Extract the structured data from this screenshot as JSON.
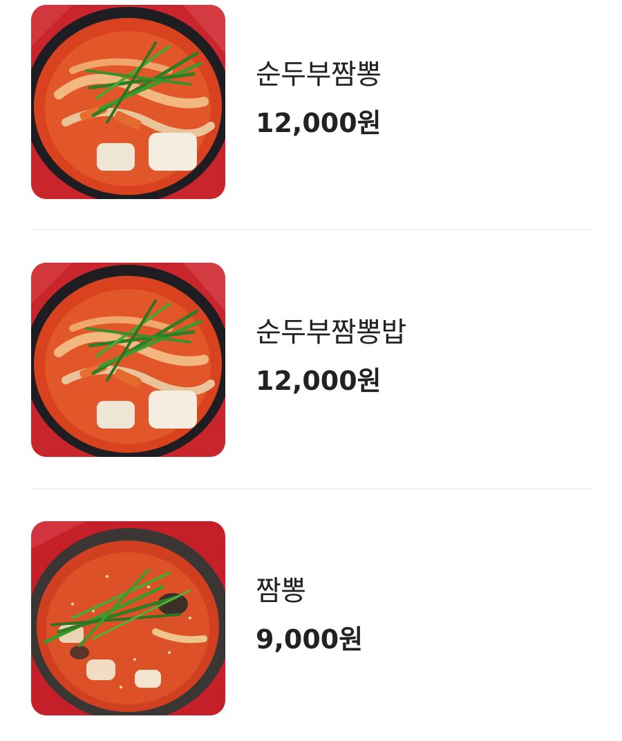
{
  "menu": {
    "items": [
      {
        "name": "순두부짬뽕",
        "price": "12,000원",
        "image": "tofu-jjamppong-photo"
      },
      {
        "name": "순두부짬뽕밥",
        "price": "12,000원",
        "image": "tofu-jjamppong-rice-photo"
      },
      {
        "name": "짬뽕",
        "price": "9,000원",
        "image": "jjamppong-photo"
      }
    ]
  }
}
